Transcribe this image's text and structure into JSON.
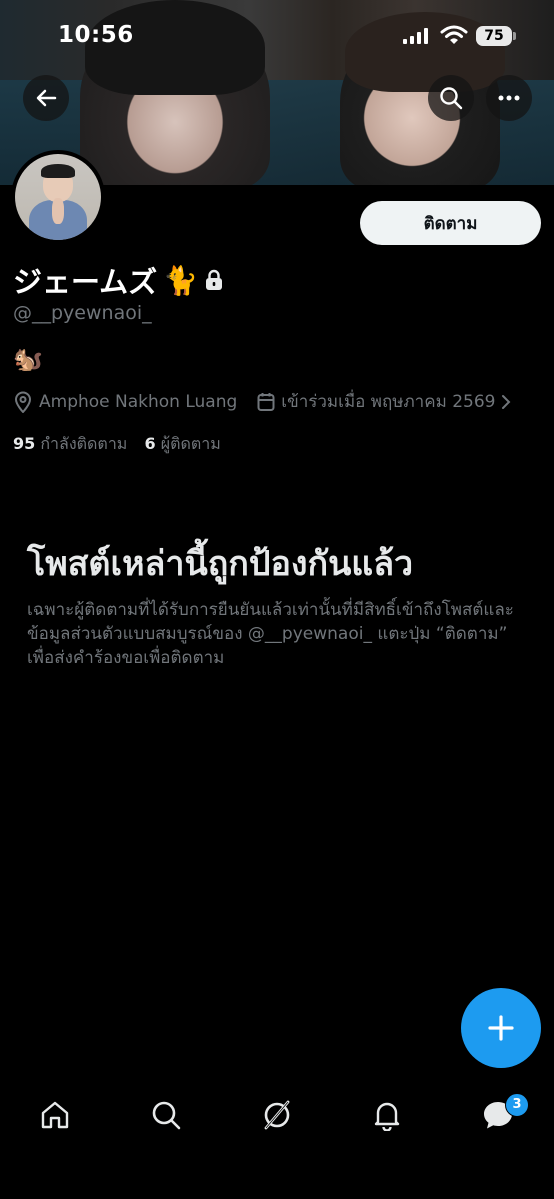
{
  "status_bar": {
    "time": "10:56",
    "battery": "75"
  },
  "profile": {
    "display_name": "ジェームズ",
    "name_emoji": "🐈",
    "handle": "@__pyewnaoi_",
    "bio": "🐿️",
    "location": "Amphoe Nakhon Luang",
    "joined": "เข้าร่วมเมื่อ พฤษภาคม 2569",
    "following_count": "95",
    "following_label": "กำลังติดตาม",
    "followers_count": "6",
    "followers_label": "ผู้ติดตาม"
  },
  "actions": {
    "follow_label": "ติดตาม"
  },
  "protected": {
    "title": "โพสต์เหล่านี้ถูกป้องกันแล้ว",
    "message": "เฉพาะผู้ติดตามที่ได้รับการยืนยันแล้วเท่านั้นที่มีสิทธิ์เข้าถึงโพสต์และข้อมูลส่วนตัวแบบสมบูรณ์ของ @__pyewnaoi_ แตะปุ่ม “ติดตาม” เพื่อส่งคำร้องขอเพื่อติดตาม"
  },
  "tabbar": {
    "messages_badge": "3"
  },
  "colors": {
    "accent": "#1d9bf0",
    "background": "#000000",
    "secondary_text": "#71767b"
  }
}
